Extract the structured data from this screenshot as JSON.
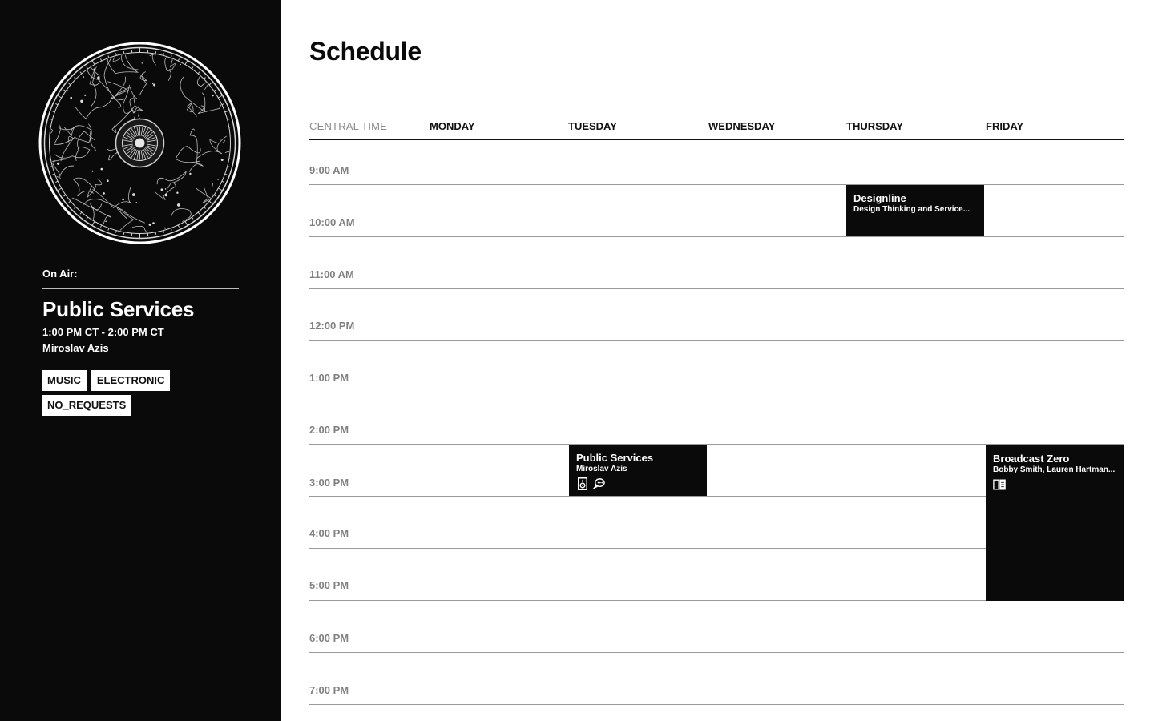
{
  "sidebar": {
    "on_air_label": "On Air:",
    "show_title": "Public Services",
    "time_range": "1:00 PM CT - 2:00 PM CT",
    "host": "Miroslav Azis",
    "tags": [
      "MUSIC",
      "ELECTRONIC",
      "NO_REQUESTS"
    ],
    "artwork": "celestial-map-artwork"
  },
  "main": {
    "title": "Schedule",
    "columns": [
      "CENTRAL TIME",
      "MONDAY",
      "TUESDAY",
      "WEDNESDAY",
      "THURSDAY",
      "FRIDAY"
    ],
    "times": [
      "9:00 AM",
      "10:00 AM",
      "11:00 AM",
      "12:00 PM",
      "1:00 PM",
      "2:00 PM",
      "3:00 PM",
      "4:00 PM",
      "5:00 PM",
      "6:00 PM",
      "7:00 PM"
    ],
    "events": [
      {
        "title": "Designline",
        "subtitle": "Design Thinking and Service...",
        "day": "THURSDAY",
        "start": "9:00 AM",
        "end": "10:00 AM",
        "icons": []
      },
      {
        "title": "Public Services",
        "subtitle": "Miroslav Azis",
        "day": "TUESDAY",
        "start": "2:00 PM",
        "end": "3:00 PM",
        "icons": [
          "speaker-icon",
          "chat-bubble-icon"
        ]
      },
      {
        "title": "Broadcast Zero",
        "subtitle": "Bobby Smith, Lauren Hartman...",
        "day": "FRIDAY",
        "start": "2:00 PM",
        "end": "5:00 PM",
        "icons": [
          "book-icon"
        ]
      }
    ]
  },
  "colors": {
    "sidebar_bg": "#0a0a0a",
    "event_bg": "#0a0a0a",
    "time_label": "#808080",
    "row_line": "#9a9a9a"
  }
}
